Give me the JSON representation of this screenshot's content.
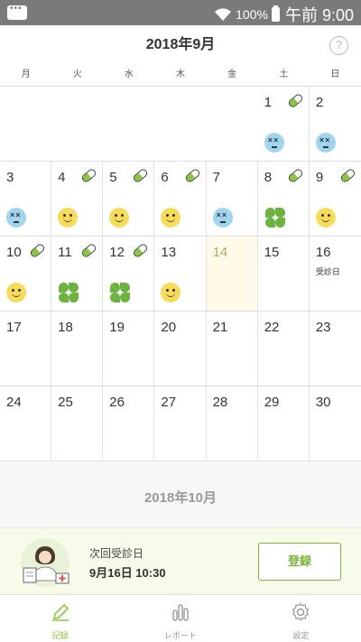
{
  "status_bar": {
    "battery": "100%",
    "time": "午前 9:00"
  },
  "header": {
    "month_title": "2018年9月",
    "help": "?"
  },
  "weekdays": [
    "月",
    "火",
    "水",
    "木",
    "金",
    "土",
    "日"
  ],
  "calendar": {
    "weeks": [
      [
        null,
        null,
        null,
        null,
        null,
        {
          "day": "1",
          "pill": true,
          "mood": "sick"
        },
        {
          "day": "2",
          "pill": false,
          "mood": "sick"
        }
      ],
      [
        {
          "day": "3",
          "pill": false,
          "mood": "sick"
        },
        {
          "day": "4",
          "pill": true,
          "mood": "smile"
        },
        {
          "day": "5",
          "pill": true,
          "mood": "smile"
        },
        {
          "day": "6",
          "pill": true,
          "mood": "smile"
        },
        {
          "day": "7",
          "pill": false,
          "mood": "sick"
        },
        {
          "day": "8",
          "pill": true,
          "mood": "clover"
        },
        {
          "day": "9",
          "pill": true,
          "mood": "smile"
        }
      ],
      [
        {
          "day": "10",
          "pill": true,
          "mood": "smile"
        },
        {
          "day": "11",
          "pill": true,
          "mood": "clover"
        },
        {
          "day": "12",
          "pill": true,
          "mood": "clover"
        },
        {
          "day": "13",
          "pill": false,
          "mood": "smile"
        },
        {
          "day": "14",
          "pill": false,
          "mood": null,
          "today": true
        },
        {
          "day": "15",
          "pill": false,
          "mood": null
        },
        {
          "day": "16",
          "pill": false,
          "mood": null,
          "note": "受診日"
        }
      ],
      [
        {
          "day": "17"
        },
        {
          "day": "18"
        },
        {
          "day": "19"
        },
        {
          "day": "20"
        },
        {
          "day": "21"
        },
        {
          "day": "22"
        },
        {
          "day": "23"
        }
      ],
      [
        {
          "day": "24"
        },
        {
          "day": "25"
        },
        {
          "day": "26"
        },
        {
          "day": "27"
        },
        {
          "day": "28"
        },
        {
          "day": "29"
        },
        {
          "day": "30"
        }
      ]
    ]
  },
  "next_month_title": "2018年10月",
  "appointment": {
    "label": "次回受診日",
    "date": "9月16日 10:30",
    "button": "登録"
  },
  "nav": [
    {
      "label": "記録",
      "icon": "pencil-icon",
      "active": true
    },
    {
      "label": "レポート",
      "icon": "bar-chart-icon",
      "active": false
    },
    {
      "label": "設定",
      "icon": "gear-icon",
      "active": false
    }
  ],
  "colors": {
    "accent": "#8cc63f",
    "today_bg": "#fffbe8",
    "smile": "#f7dc5a",
    "sick": "#9fd5ee",
    "clover": "#6cb33f"
  }
}
